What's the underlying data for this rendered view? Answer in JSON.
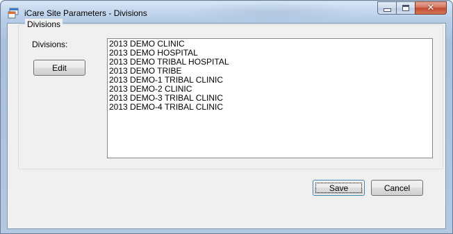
{
  "window": {
    "title": "iCare Site Parameters - Divisions",
    "controls": {
      "minimize": "minimize",
      "maximize": "maximize",
      "close": "close"
    }
  },
  "group": {
    "title": "Divisions"
  },
  "divisions": {
    "label": "Divisions:",
    "items": [
      "2013 DEMO CLINIC",
      "2013 DEMO HOSPITAL",
      "2013 DEMO TRIBAL HOSPITAL",
      "2013 DEMO TRIBE",
      "2013 DEMO-1 TRIBAL CLINIC",
      "2013 DEMO-2 CLINIC",
      "2013 DEMO-3 TRIBAL CLINIC",
      "2013 DEMO-4 TRIBAL CLINIC"
    ]
  },
  "buttons": {
    "edit": "Edit",
    "save": "Save",
    "cancel": "Cancel"
  },
  "icons": {
    "app": "app-window-icon",
    "minimize": "minimize-icon",
    "maximize": "maximize-icon",
    "close": "close-icon"
  },
  "colors": {
    "client_background": "#f0f0f0",
    "close_button": "#c24b31",
    "default_button_border": "#3c7fb1"
  }
}
